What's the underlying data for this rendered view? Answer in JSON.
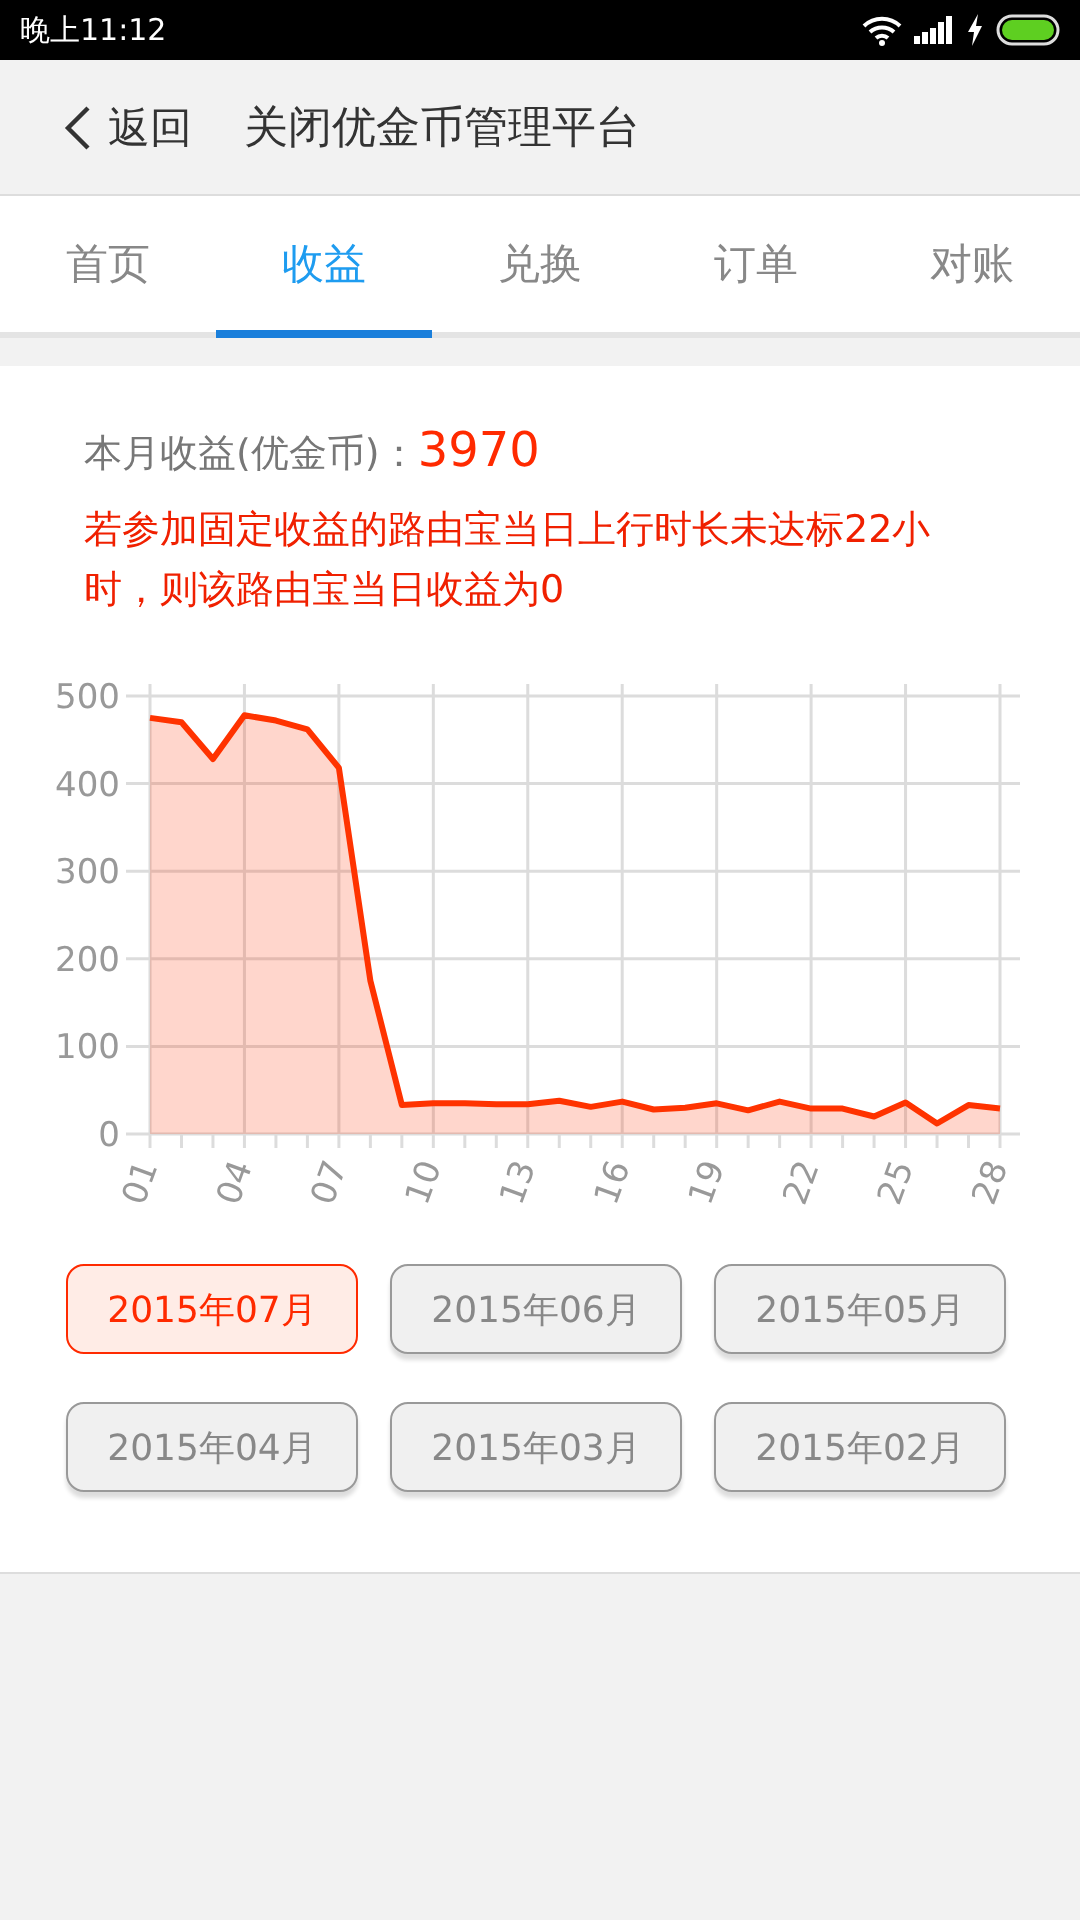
{
  "status_bar": {
    "time": "晚上11:12"
  },
  "header": {
    "back": "返回",
    "title": "关闭优金币管理平台"
  },
  "tabs": [
    {
      "label": "首页",
      "selected": false
    },
    {
      "label": "收益",
      "selected": true
    },
    {
      "label": "兑换",
      "selected": false
    },
    {
      "label": "订单",
      "selected": false
    },
    {
      "label": "对账",
      "selected": false
    }
  ],
  "summary": {
    "label": "本月收益(优金币)：",
    "value": "3970"
  },
  "notice": "若参加固定收益的路由宝当日上行时长未达标22小时，则该路由宝当日收益为0",
  "chart_data": {
    "type": "area",
    "x": [
      1,
      2,
      3,
      4,
      5,
      6,
      7,
      8,
      9,
      10,
      11,
      12,
      13,
      14,
      15,
      16,
      17,
      18,
      19,
      20,
      21,
      22,
      23,
      24,
      25,
      26,
      27,
      28
    ],
    "xlim": [
      1,
      28
    ],
    "grid": true,
    "series": [
      {
        "color": "#ff3300",
        "values": [
          475,
          470,
          428,
          478,
          472,
          462,
          418,
          175,
          33,
          35,
          35,
          34,
          34,
          38,
          31,
          37,
          28,
          30,
          35,
          27,
          37,
          29,
          29,
          20,
          36,
          12,
          33,
          29
        ]
      }
    ],
    "ylim": [
      0,
      500
    ],
    "yticks": [
      0,
      100,
      200,
      300,
      400,
      500
    ],
    "xticks": [
      {
        "value": 1,
        "label": "01"
      },
      {
        "value": 4,
        "label": "04"
      },
      {
        "value": 7,
        "label": "07"
      },
      {
        "value": 10,
        "label": "10"
      },
      {
        "value": 13,
        "label": "13"
      },
      {
        "value": 16,
        "label": "16"
      },
      {
        "value": 19,
        "label": "19"
      },
      {
        "value": 22,
        "label": "22"
      },
      {
        "value": 25,
        "label": "25"
      },
      {
        "value": 28,
        "label": "28"
      }
    ]
  },
  "months": [
    {
      "label": "2015年07月",
      "selected": true
    },
    {
      "label": "2015年06月",
      "selected": false
    },
    {
      "label": "2015年05月",
      "selected": false
    },
    {
      "label": "2015年04月",
      "selected": false
    },
    {
      "label": "2015年03月",
      "selected": false
    },
    {
      "label": "2015年02月",
      "selected": false
    }
  ]
}
